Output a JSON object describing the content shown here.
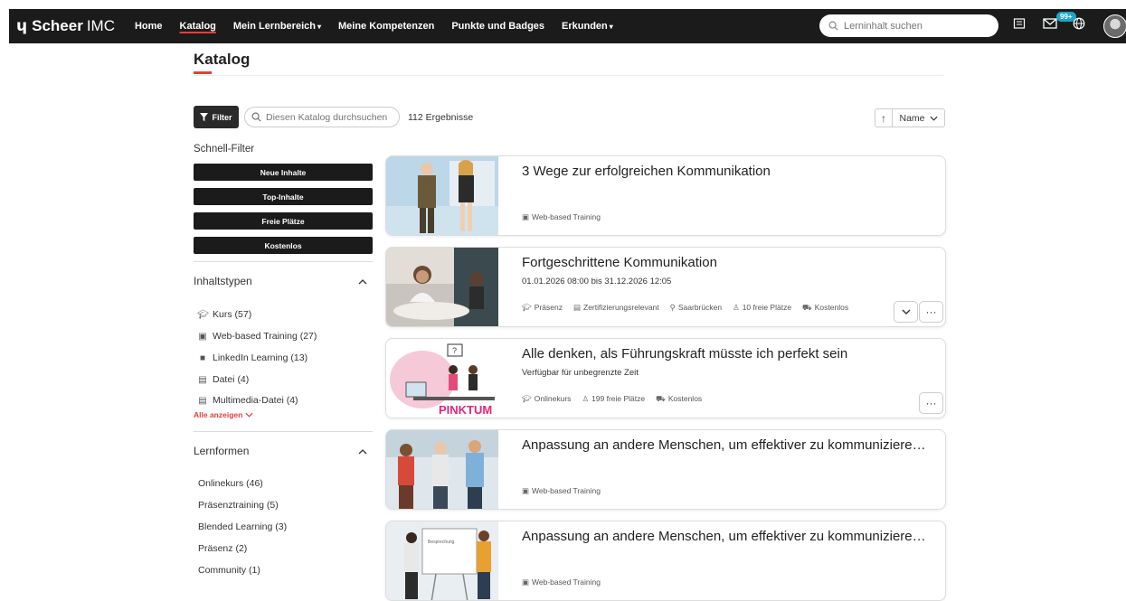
{
  "app": {
    "brand_mark": "ɥ",
    "brand_name": "Scheer",
    "brand_sub": "IMC"
  },
  "nav": {
    "items": [
      {
        "label": "Home",
        "active": false,
        "dropdown": false
      },
      {
        "label": "Katalog",
        "active": true,
        "dropdown": false
      },
      {
        "label": "Mein Lernbereich",
        "active": false,
        "dropdown": true
      },
      {
        "label": "Meine Kompetenzen",
        "active": false,
        "dropdown": false
      },
      {
        "label": "Punkte und Badges",
        "active": false,
        "dropdown": false
      },
      {
        "label": "Erkunden",
        "active": false,
        "dropdown": true
      }
    ],
    "search_placeholder": "Lerninhalt suchen",
    "notification_count": "99+"
  },
  "page": {
    "title": "Katalog"
  },
  "toolbar": {
    "filter_label": "Filter",
    "search_placeholder": "Diesen Katalog durchsuchen",
    "result_count": "112 Ergebnisse",
    "sort_direction_icon": "arrow-up-icon",
    "sort_value": "Name"
  },
  "sidebar": {
    "quick_filter_title": "Schnell-Filter",
    "quick_filters": [
      "Neue Inhalte",
      "Top-Inhalte",
      "Freie Plätze",
      "Kostenlos"
    ],
    "content_types": {
      "title": "Inhaltstypen",
      "items": [
        {
          "icon": "graduation-cap-icon",
          "label": "Kurs",
          "count": "(57)"
        },
        {
          "icon": "web-training-icon",
          "label": "Web-based Training",
          "count": "(27)"
        },
        {
          "icon": "linkedin-icon",
          "label": "LinkedIn Learning",
          "count": "(13)"
        },
        {
          "icon": "file-icon",
          "label": "Datei",
          "count": "(4)"
        },
        {
          "icon": "media-file-icon",
          "label": "Multimedia-Datei",
          "count": "(4)"
        }
      ],
      "show_all": "Alle anzeigen"
    },
    "learning_forms": {
      "title": "Lernformen",
      "items": [
        {
          "label": "Onlinekurs",
          "count": "(46)"
        },
        {
          "label": "Präsenztraining",
          "count": "(5)"
        },
        {
          "label": "Blended Learning",
          "count": "(3)"
        },
        {
          "label": "Präsenz",
          "count": "(2)"
        },
        {
          "label": "Community",
          "count": "(1)"
        }
      ]
    }
  },
  "cards": [
    {
      "title": "3 Wege zur erfolgreichen Kommunikation",
      "subtitle": "",
      "meta": [
        {
          "icon": "web-training-icon",
          "label": "Web-based Training"
        }
      ],
      "expand": false,
      "more": false
    },
    {
      "title": "Fortgeschrittene Kommunikation",
      "subtitle": "01.01.2026 08:00 bis 31.12.2026 12:05",
      "meta": [
        {
          "icon": "graduation-cap-icon",
          "label": "Präsenz"
        },
        {
          "icon": "certificate-icon",
          "label": "Zertifizierungsrelevant"
        },
        {
          "icon": "location-icon",
          "label": "Saarbrücken"
        },
        {
          "icon": "seat-icon",
          "label": "10 freie Plätze"
        },
        {
          "icon": "cart-icon",
          "label": "Kostenlos"
        }
      ],
      "expand": true,
      "more": true
    },
    {
      "title": "Alle denken, als Führungskraft müsste ich perfekt sein",
      "subtitle": "Verfügbar für unbegrenzte Zeit",
      "meta": [
        {
          "icon": "graduation-cap-icon",
          "label": "Onlinekurs"
        },
        {
          "icon": "seat-icon",
          "label": "199 freie Plätze"
        },
        {
          "icon": "cart-icon",
          "label": "Kostenlos"
        }
      ],
      "thumb_text": "PINKTUM",
      "expand": false,
      "more": true
    },
    {
      "title": "Anpassung an andere Menschen, um effektiver zu kommuniziere…",
      "subtitle": "",
      "meta": [
        {
          "icon": "web-training-icon",
          "label": "Web-based Training"
        }
      ],
      "expand": false,
      "more": false
    },
    {
      "title": "Anpassung an andere Menschen, um effektiver zu kommuniziere…",
      "subtitle": "",
      "meta": [
        {
          "icon": "web-training-icon",
          "label": "Web-based Training"
        }
      ],
      "thumb_text": "Besprechung",
      "expand": false,
      "more": false
    }
  ],
  "colors": {
    "topbar": "#1b1b1b",
    "accent": "#e0403a",
    "badge": "#1aa6c8",
    "pinktum": "#e3277a"
  }
}
